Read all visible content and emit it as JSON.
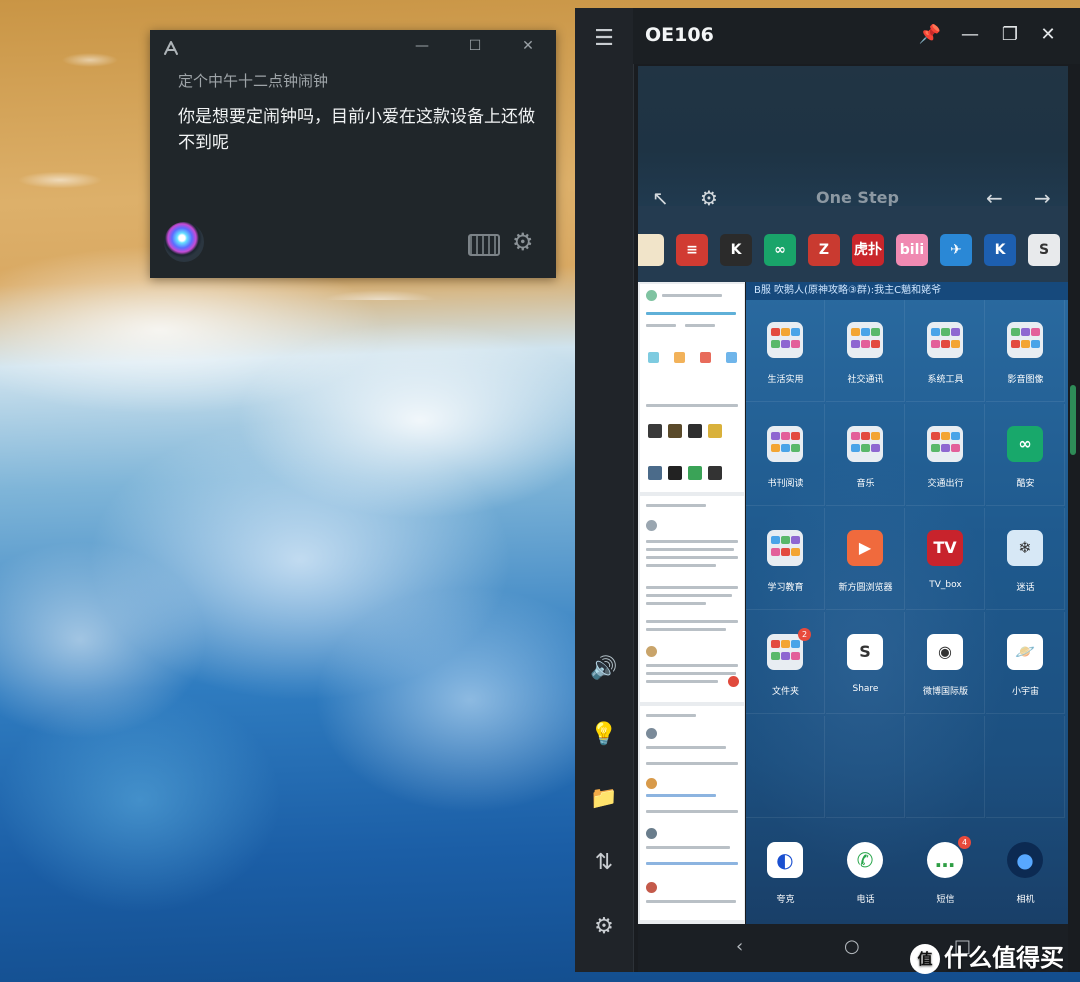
{
  "assistant": {
    "query": "定个中午十二点钟闹钟",
    "reply": "你是想要定闹钟吗，目前小爱在这款设备上还做不到呢",
    "logo_icon": "xiaoai-logo-icon",
    "minimize": "—",
    "maximize": "☐",
    "close": "✕"
  },
  "window": {
    "title": "OE106",
    "pin": "📌",
    "minimize": "—",
    "restore": "❐",
    "close": "✕"
  },
  "rail": {
    "menu": "☰",
    "volume": "🔊",
    "bulb": "💡",
    "folder": "📁",
    "transfer": "⇅",
    "settings": "⚙"
  },
  "onestep": {
    "title": "One Step",
    "back_arrow": "←",
    "forward_arrow": "→",
    "collapse": "↖",
    "settings": "⚙"
  },
  "dock_apps": [
    {
      "label": "",
      "color": "#f1e4c9"
    },
    {
      "label": "≡",
      "color": "#d13b32"
    },
    {
      "label": "K",
      "color": "#2b2b2b"
    },
    {
      "label": "∞",
      "color": "#19a46a"
    },
    {
      "label": "Z",
      "color": "#c93a30"
    },
    {
      "label": "虎扑",
      "color": "#c9262b"
    },
    {
      "label": "bili",
      "color": "#f08ab2"
    },
    {
      "label": "✈",
      "color": "#2a88d6"
    },
    {
      "label": "K",
      "color": "#1d5fb0"
    },
    {
      "label": "S",
      "color": "#e8eaec"
    }
  ],
  "notification": "B服 吹鹅人(原神攻略③群):我主C魈和姥爷",
  "home_grid": [
    {
      "label": "生活实用",
      "type": "folder"
    },
    {
      "label": "社交通讯",
      "type": "folder"
    },
    {
      "label": "系统工具",
      "type": "folder"
    },
    {
      "label": "影音图像",
      "type": "folder"
    },
    {
      "label": "书刊阅读",
      "type": "folder"
    },
    {
      "label": "音乐",
      "type": "folder"
    },
    {
      "label": "交通出行",
      "type": "folder"
    },
    {
      "label": "酷安",
      "type": "app",
      "color": "#18a86b",
      "glyph": "∞"
    },
    {
      "label": "学习教育",
      "type": "folder"
    },
    {
      "label": "新方圆浏览器",
      "type": "app",
      "color": "#f06a3d",
      "glyph": "▶"
    },
    {
      "label": "TV_box",
      "type": "app",
      "color": "#c8232c",
      "glyph": "TV"
    },
    {
      "label": "迷话",
      "type": "app",
      "color": "#d7e8f6",
      "glyph": "❄"
    },
    {
      "label": "文件夹",
      "type": "folder",
      "badge": "2"
    },
    {
      "label": "Share",
      "type": "app",
      "color": "#ffffff",
      "glyph": "S"
    },
    {
      "label": "微博国际版",
      "type": "app",
      "color": "#ffffff",
      "glyph": "◉"
    },
    {
      "label": "小宇宙",
      "type": "app",
      "color": "#ffffff",
      "glyph": "🪐"
    }
  ],
  "dock": [
    {
      "label": "夸克",
      "color": "#ffffff",
      "glyph": "◐"
    },
    {
      "label": "电话",
      "color": "#ffffff",
      "glyph": "✆"
    },
    {
      "label": "短信",
      "color": "#ffffff",
      "glyph": "…",
      "badge": "4"
    },
    {
      "label": "相机",
      "color": "#0c2a52",
      "glyph": "●"
    }
  ],
  "nav": {
    "back": "‹",
    "home": "○",
    "recents": "□"
  },
  "watermark": {
    "icon_text": "值",
    "text": "什么值得买"
  }
}
